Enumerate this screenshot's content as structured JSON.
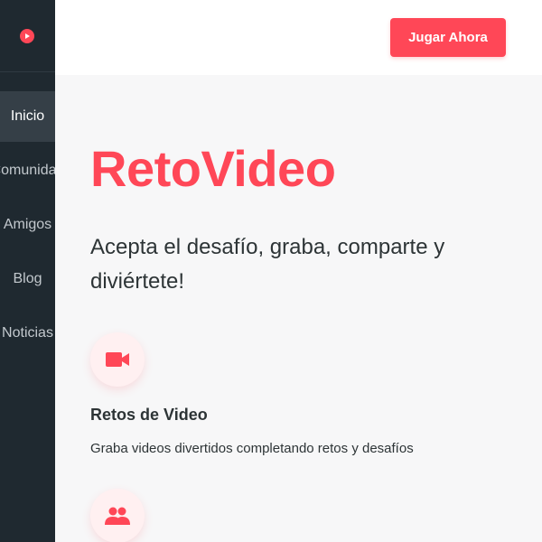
{
  "sidebar": {
    "logo_icon": "play-circle-icon",
    "items": [
      {
        "label": "Inicio",
        "active": true
      },
      {
        "label": "Comunidad",
        "active": false
      },
      {
        "label": "Amigos",
        "active": false
      },
      {
        "label": "Blog",
        "active": false
      },
      {
        "label": "Noticias",
        "active": false
      }
    ]
  },
  "header": {
    "cta_label": "Jugar Ahora"
  },
  "hero": {
    "title": "RetoVideo",
    "subtitle": "Acepta el desafío, graba, comparte y diviértete!"
  },
  "features": [
    {
      "icon": "video-camera-icon",
      "title": "Retos de Video",
      "description": "Graba videos divertidos completando retos y desafíos"
    },
    {
      "icon": "people-icon"
    }
  ],
  "colors": {
    "accent": "#ff4757",
    "sidebar_bg": "#1f2930",
    "sidebar_active": "#353f47",
    "text": "#2d3436"
  }
}
